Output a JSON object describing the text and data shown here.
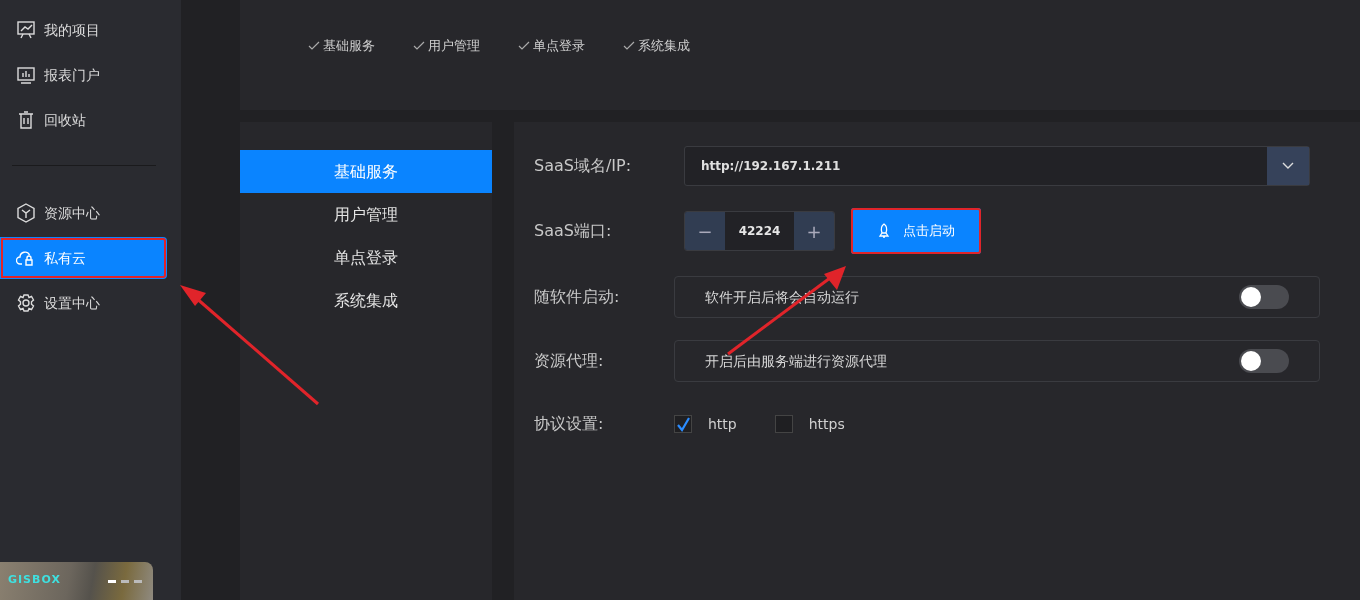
{
  "sidebar": {
    "items": [
      {
        "label": "我的项目",
        "selected": false,
        "highlighted": false
      },
      {
        "label": "报表门户",
        "selected": false,
        "highlighted": false
      },
      {
        "label": "回收站",
        "selected": false,
        "highlighted": false
      },
      {
        "kind": "divider"
      },
      {
        "label": "资源中心",
        "selected": false,
        "highlighted": false
      },
      {
        "label": "私有云",
        "selected": true,
        "highlighted": true
      },
      {
        "label": "设置中心",
        "selected": false,
        "highlighted": false
      }
    ],
    "banner": {
      "logo": "GISBOX",
      "slides": [
        {
          "selected": true
        },
        {
          "selected": false
        },
        {
          "selected": false
        }
      ]
    }
  },
  "steps": [
    {
      "label": "基础服务",
      "done": true
    },
    {
      "label": "用户管理",
      "done": true
    },
    {
      "label": "单点登录",
      "done": true
    },
    {
      "label": "系统集成",
      "done": true
    }
  ],
  "submenu": [
    {
      "label": "基础服务",
      "selected": true
    },
    {
      "label": "用户管理",
      "selected": false
    },
    {
      "label": "单点登录",
      "selected": false
    },
    {
      "label": "系统集成",
      "selected": false
    }
  ],
  "form": [
    {
      "kind": "select",
      "label": "SaaS域名/IP:",
      "value": "http://192.167.1.211"
    },
    {
      "kind": "port",
      "label": "SaaS端口:",
      "value": "42224",
      "minus": "−",
      "plus": "+",
      "button": "点击启动",
      "button_highlighted": true
    },
    {
      "kind": "switch",
      "label": "随软件启动:",
      "text": "软件开启后将会自动运行",
      "on": false
    },
    {
      "kind": "switch",
      "label": "资源代理:",
      "text": "开启后由服务端进行资源代理",
      "on": false
    },
    {
      "kind": "checks",
      "label": "协议设置:",
      "options": [
        {
          "label": "http",
          "checked": true
        },
        {
          "label": "https",
          "checked": false
        }
      ]
    }
  ]
}
